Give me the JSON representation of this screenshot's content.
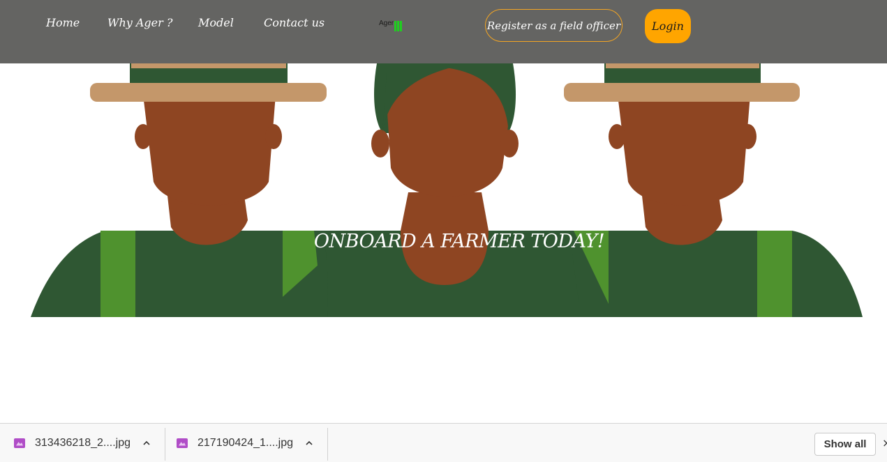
{
  "nav": {
    "links": [
      "Home",
      "Why Ager ?",
      "Model",
      "Contact us"
    ],
    "logo_text": "Ager",
    "register_label": "Register as a field officer",
    "login_label": "Login"
  },
  "hero": {
    "title": "ONBOARD A FARMER TODAY!"
  },
  "downloads": {
    "items": [
      {
        "name": "313436218_2....jpg",
        "icon": "image-file-icon"
      },
      {
        "name": "217190424_1....jpg",
        "icon": "image-file-icon"
      }
    ],
    "show_all_label": "Show all"
  },
  "colors": {
    "navbar": "#646462",
    "accent": "#ffa500",
    "skin": "#8e4522",
    "shirt": "#2f5733",
    "strap": "#4f922e",
    "hat_brim": "#c4976a"
  }
}
